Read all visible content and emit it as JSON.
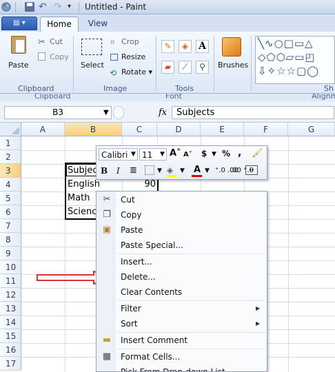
{
  "window": {
    "title": "Untitled - Paint"
  },
  "tabs": [
    {
      "label": "Home"
    },
    {
      "label": "View"
    }
  ],
  "ribbon": {
    "clipboard": {
      "paste": "Paste",
      "cut": "Cut",
      "copy": "Copy",
      "group_label": "Clipboard"
    },
    "image": {
      "select": "Select",
      "crop": "Crop",
      "resize": "Resize",
      "rotate": "Rotate ▾",
      "group_label": "Image"
    },
    "tools": {
      "group_label": "Tools"
    },
    "brushes": {
      "label": "Brushes"
    },
    "shapes": {
      "group_label": "Sh"
    }
  },
  "excel": {
    "group_strip": {
      "clipboard": "Clipboard",
      "font": "Font",
      "alignment": "Alignm"
    },
    "name_box": "B3",
    "formula_value": "Subjects",
    "columns": [
      "A",
      "B",
      "C",
      "D",
      "E",
      "F",
      "G"
    ],
    "rows": [
      "1",
      "2",
      "3",
      "4",
      "5",
      "6",
      "7",
      "8",
      "9",
      "10",
      "11",
      "12",
      "13",
      "14",
      "15",
      "16",
      "17"
    ],
    "cells": {
      "B3": "Subjects",
      "B4": "English",
      "C4": "90",
      "B5": "Math",
      "B6": "Science"
    }
  },
  "mini_toolbar": {
    "font_name": "Calibri",
    "font_size": "11",
    "currency": "$",
    "percent": "%",
    "comma": ",",
    "bold": "B",
    "italic": "I",
    "font_color": "A",
    "increase_decimal": "⁺.0 .00",
    "decrease_decimal": ".00 ⁺.0",
    "fill_color": "#ffff00",
    "font_color_swatch": "#e00000"
  },
  "context_menu": {
    "items": [
      {
        "label": "Cut",
        "icon": "scissors-icon"
      },
      {
        "label": "Copy",
        "icon": "copy-icon"
      },
      {
        "label": "Paste",
        "icon": "paste-icon"
      },
      {
        "label": "Paste Special...",
        "icon": ""
      },
      {
        "label": "Insert...",
        "icon": ""
      },
      {
        "label": "Delete...",
        "icon": ""
      },
      {
        "label": "Clear Contents",
        "icon": ""
      },
      {
        "label": "Filter",
        "icon": "",
        "submenu": true
      },
      {
        "label": "Sort",
        "icon": "",
        "submenu": true
      },
      {
        "label": "Insert Comment",
        "icon": "comment-icon"
      },
      {
        "label": "Format Cells...",
        "icon": "format-cells-icon"
      },
      {
        "label": "Pick From Drop-down List...",
        "icon": ""
      }
    ]
  },
  "colors": {
    "annotation_arrow": "#e03030",
    "selected_header": "#f6cf7b",
    "accent": "#2a5bb1"
  }
}
